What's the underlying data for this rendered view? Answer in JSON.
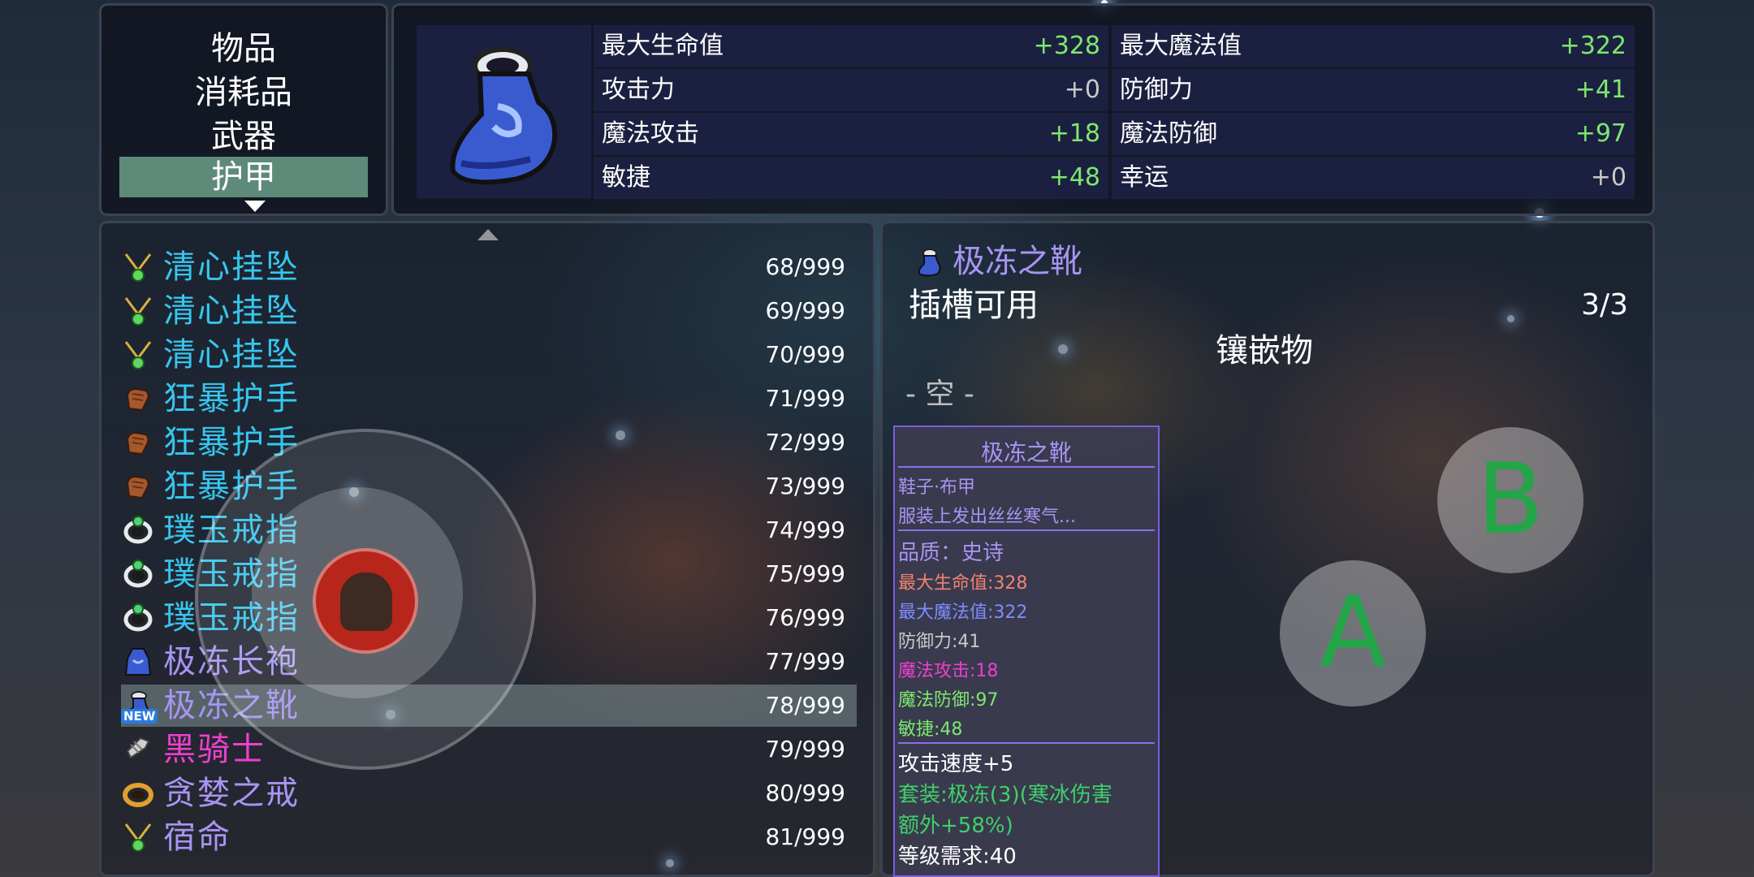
{
  "categories": {
    "items": [
      "物品",
      "消耗品",
      "武器",
      "护甲"
    ],
    "selected": "护甲"
  },
  "stats": {
    "left": [
      {
        "label": "最大生命值",
        "value": "+328"
      },
      {
        "label": "攻击力",
        "value": "+0"
      },
      {
        "label": "魔法攻击",
        "value": "+18"
      },
      {
        "label": "敏捷",
        "value": "+48"
      }
    ],
    "right": [
      {
        "label": "最大魔法值",
        "value": "+322"
      },
      {
        "label": "防御力",
        "value": "+41"
      },
      {
        "label": "魔法防御",
        "value": "+97"
      },
      {
        "label": "幸运",
        "value": "+0"
      }
    ]
  },
  "inventory": {
    "items": [
      {
        "name": "清心挂坠",
        "count": "68/999",
        "icon": "pendant-icon",
        "color": "#36c6ee"
      },
      {
        "name": "清心挂坠",
        "count": "69/999",
        "icon": "pendant-icon",
        "color": "#36c6ee"
      },
      {
        "name": "清心挂坠",
        "count": "70/999",
        "icon": "pendant-icon",
        "color": "#36c6ee"
      },
      {
        "name": "狂暴护手",
        "count": "71/999",
        "icon": "gauntlet-icon",
        "color": "#36c6ee"
      },
      {
        "name": "狂暴护手",
        "count": "72/999",
        "icon": "gauntlet-icon",
        "color": "#36c6ee"
      },
      {
        "name": "狂暴护手",
        "count": "73/999",
        "icon": "gauntlet-icon",
        "color": "#36c6ee"
      },
      {
        "name": "璞玉戒指",
        "count": "74/999",
        "icon": "ring-icon",
        "color": "#36c6ee"
      },
      {
        "name": "璞玉戒指",
        "count": "75/999",
        "icon": "ring-icon",
        "color": "#36c6ee"
      },
      {
        "name": "璞玉戒指",
        "count": "76/999",
        "icon": "ring-icon",
        "color": "#36c6ee"
      },
      {
        "name": "极冻长袍",
        "count": "77/999",
        "icon": "robe-icon",
        "color": "#a894f2"
      },
      {
        "name": "极冻之靴",
        "count": "78/999",
        "icon": "boots-icon",
        "color": "#a894f2",
        "badge": "NEW"
      },
      {
        "name": "黑骑士",
        "count": "79/999",
        "icon": "armor-icon",
        "color": "#ef3fd0"
      },
      {
        "name": "贪婪之戒",
        "count": "80/999",
        "icon": "gold-ring-icon",
        "color": "#a894f2"
      },
      {
        "name": "宿命",
        "count": "81/999",
        "icon": "pendant-icon",
        "color": "#a894f2"
      }
    ],
    "selected": "极冻之靴"
  },
  "detail": {
    "name": "极冻之靴",
    "slots_label": "插槽可用",
    "slots_value": "3/3",
    "inlay_label": "镶嵌物",
    "empty_slot": "- 空 -"
  },
  "tooltip": {
    "title": "极冻之靴",
    "type": "鞋子·布甲",
    "desc": "服装上发出丝丝寒气...",
    "quality": "品质：史诗",
    "hp": "最大生命值:328",
    "mp": "最大魔法值:322",
    "def": "防御力:41",
    "matk": "魔法攻击:18",
    "mdef": "魔法防御:97",
    "agi": "敏捷:48",
    "atk_speed": "攻击速度+5",
    "set": "套装:极冻(3)(寒冰伤害",
    "set_bonus": "额外+58%)",
    "level_req": "等级需求:40"
  },
  "controls": {
    "a_label": "A",
    "b_label": "B"
  },
  "colors": {
    "positive": "#7de86f",
    "selected_category": "#5e8a7a",
    "epic": "#a894f2",
    "rare": "#36c6ee",
    "legendary": "#ef3fd0",
    "button_letter": "#23a548"
  }
}
